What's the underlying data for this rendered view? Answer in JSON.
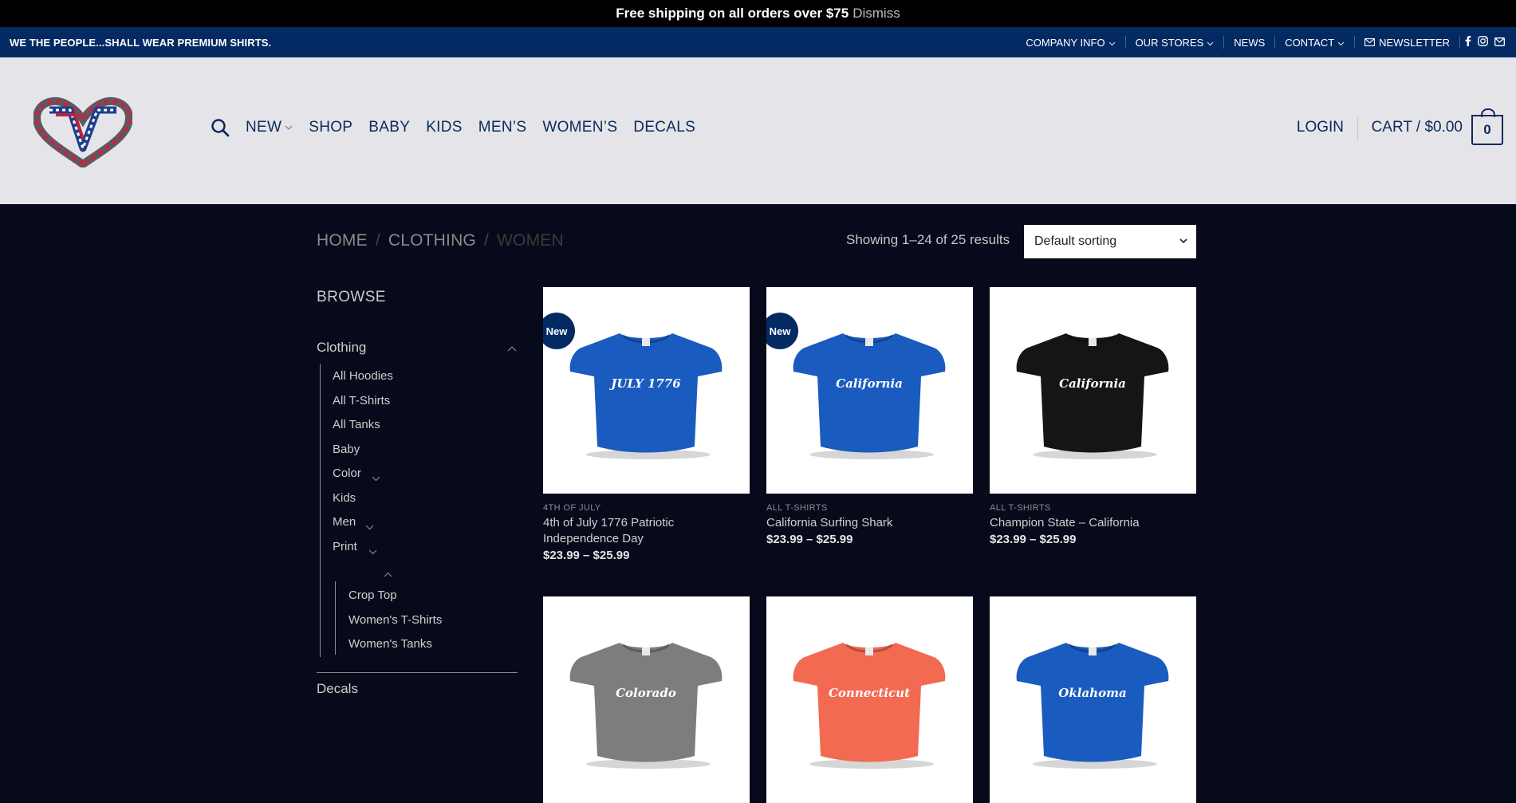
{
  "promo": {
    "text": "Free shipping on all orders over $75",
    "dismiss": "Dismiss"
  },
  "topbar": {
    "tagline": "WE THE PEOPLE...SHALL WEAR PREMIUM SHIRTS.",
    "items": [
      "COMPANY INFO",
      "OUR STORES",
      "NEWS",
      "CONTACT",
      "NEWSLETTER"
    ]
  },
  "header": {
    "nav": [
      "NEW",
      "SHOP",
      "BABY",
      "KIDS",
      "MEN’S",
      "WOMEN’S",
      "DECALS"
    ],
    "login": "LOGIN",
    "cart": "CART / $0.00",
    "cart_count": "0"
  },
  "breadcrumbs": [
    "HOME",
    "CLOTHING",
    "WOMEN"
  ],
  "results_text": "Showing 1–24 of 25 results",
  "sort": {
    "selected": "Default sorting"
  },
  "sidebar": {
    "heading": "BROWSE",
    "category": "Clothing",
    "subcategories": [
      "All Hoodies",
      "All T-Shirts",
      "All Tanks",
      "Baby",
      "Color",
      "Kids",
      "Men",
      "Print"
    ],
    "women_items": [
      "Crop Top",
      "Women's T-Shirts",
      "Women's Tanks"
    ],
    "next_category": "Decals"
  },
  "products": [
    {
      "badge": "New",
      "category": "4TH OF JULY",
      "title": "4th of July 1776 Patriotic Independence Day",
      "price": "$23.99 – $25.99",
      "shirt_color": "#1a5bbf",
      "print_text": "JULY 1776"
    },
    {
      "badge": "New",
      "category": "ALL T-SHIRTS",
      "title": "California Surfing Shark",
      "price": "$23.99 – $25.99",
      "shirt_color": "#1a5bbf",
      "print_text": "California"
    },
    {
      "badge": "",
      "category": "ALL T-SHIRTS",
      "title": "Champion State – California",
      "price": "$23.99 – $25.99",
      "shirt_color": "#151515",
      "print_text": "California"
    },
    {
      "badge": "",
      "category": "",
      "title": "",
      "price": "",
      "shirt_color": "#7d7d7d",
      "print_text": "Colorado"
    },
    {
      "badge": "",
      "category": "",
      "title": "",
      "price": "",
      "shirt_color": "#f26a52",
      "print_text": "Connecticut"
    },
    {
      "badge": "",
      "category": "",
      "title": "",
      "price": "",
      "shirt_color": "#1a5bbf",
      "print_text": "Oklahoma"
    }
  ]
}
